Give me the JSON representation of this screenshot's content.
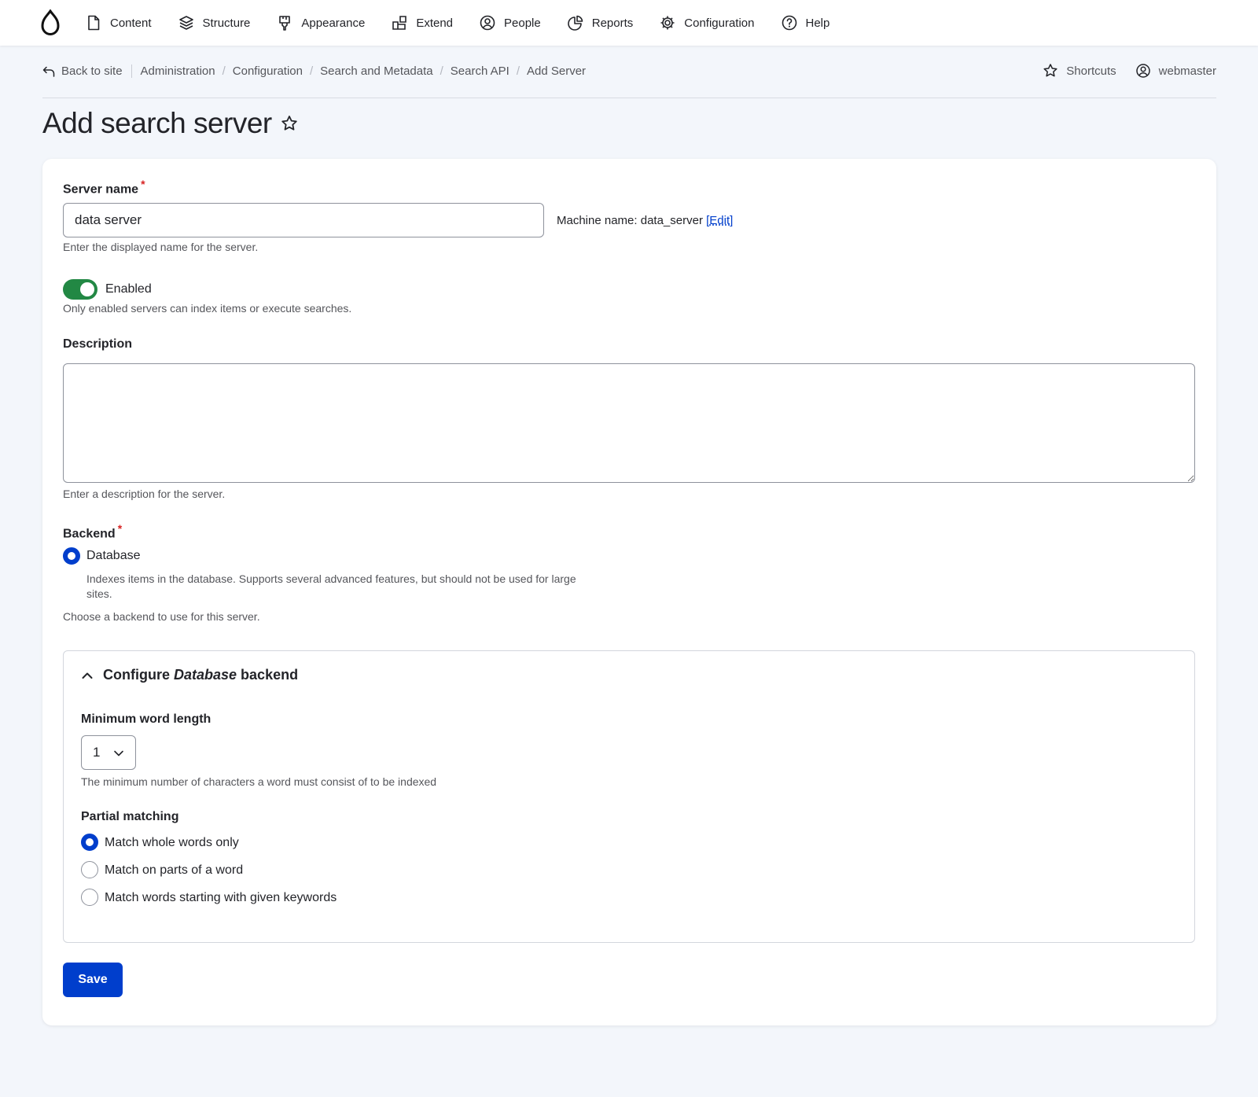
{
  "topnav": {
    "items": [
      {
        "label": "Content",
        "icon": "document-icon"
      },
      {
        "label": "Structure",
        "icon": "layers-icon"
      },
      {
        "label": "Appearance",
        "icon": "paint-brush-icon"
      },
      {
        "label": "Extend",
        "icon": "puzzle-blocks-icon"
      },
      {
        "label": "People",
        "icon": "user-circle-icon"
      },
      {
        "label": "Reports",
        "icon": "pie-chart-icon"
      },
      {
        "label": "Configuration",
        "icon": "gear-icon"
      },
      {
        "label": "Help",
        "icon": "help-circle-icon"
      }
    ]
  },
  "breadcrumb": {
    "back_label": "Back to site",
    "items": [
      "Administration",
      "Configuration",
      "Search and Metadata",
      "Search API",
      "Add Server"
    ]
  },
  "header_links": {
    "shortcuts": "Shortcuts",
    "user": "webmaster"
  },
  "page": {
    "title": "Add search server"
  },
  "form": {
    "server_name": {
      "label": "Server name",
      "required_mark": "*",
      "value": "data server",
      "machine_name_prefix": "Machine name: data_server ",
      "edit_open": "[",
      "edit_link": "Edit",
      "edit_close": "]",
      "description": "Enter the displayed name for the server."
    },
    "enabled": {
      "label": "Enabled",
      "checked": true,
      "description": "Only enabled servers can index items or execute searches."
    },
    "description_field": {
      "label": "Description",
      "value": "",
      "description": "Enter a description for the server."
    },
    "backend": {
      "label": "Backend",
      "required_mark": "*",
      "option_label": "Database",
      "option_description_line1": "Indexes items in the database. Supports several advanced features, but should not be used for large",
      "option_description_line2": "sites.",
      "description": "Choose a backend to use for this server."
    },
    "backend_config": {
      "summary_prefix": "Configure",
      "summary_emphasis": "Database",
      "summary_suffix": "backend",
      "min_word_length": {
        "label": "Minimum word length",
        "value": "1",
        "description": "The minimum number of characters a word must consist of to be indexed"
      },
      "partial_matching": {
        "label": "Partial matching",
        "options": [
          {
            "label": "Match whole words only",
            "checked": true
          },
          {
            "label": "Match on parts of a word",
            "checked": false
          },
          {
            "label": "Match words starting with given keywords",
            "checked": false
          }
        ]
      }
    },
    "save_label": "Save"
  },
  "colors": {
    "primary": "#003ecc",
    "toggle_on": "#228844",
    "required": "#d72222",
    "background": "#f3f6fb"
  }
}
